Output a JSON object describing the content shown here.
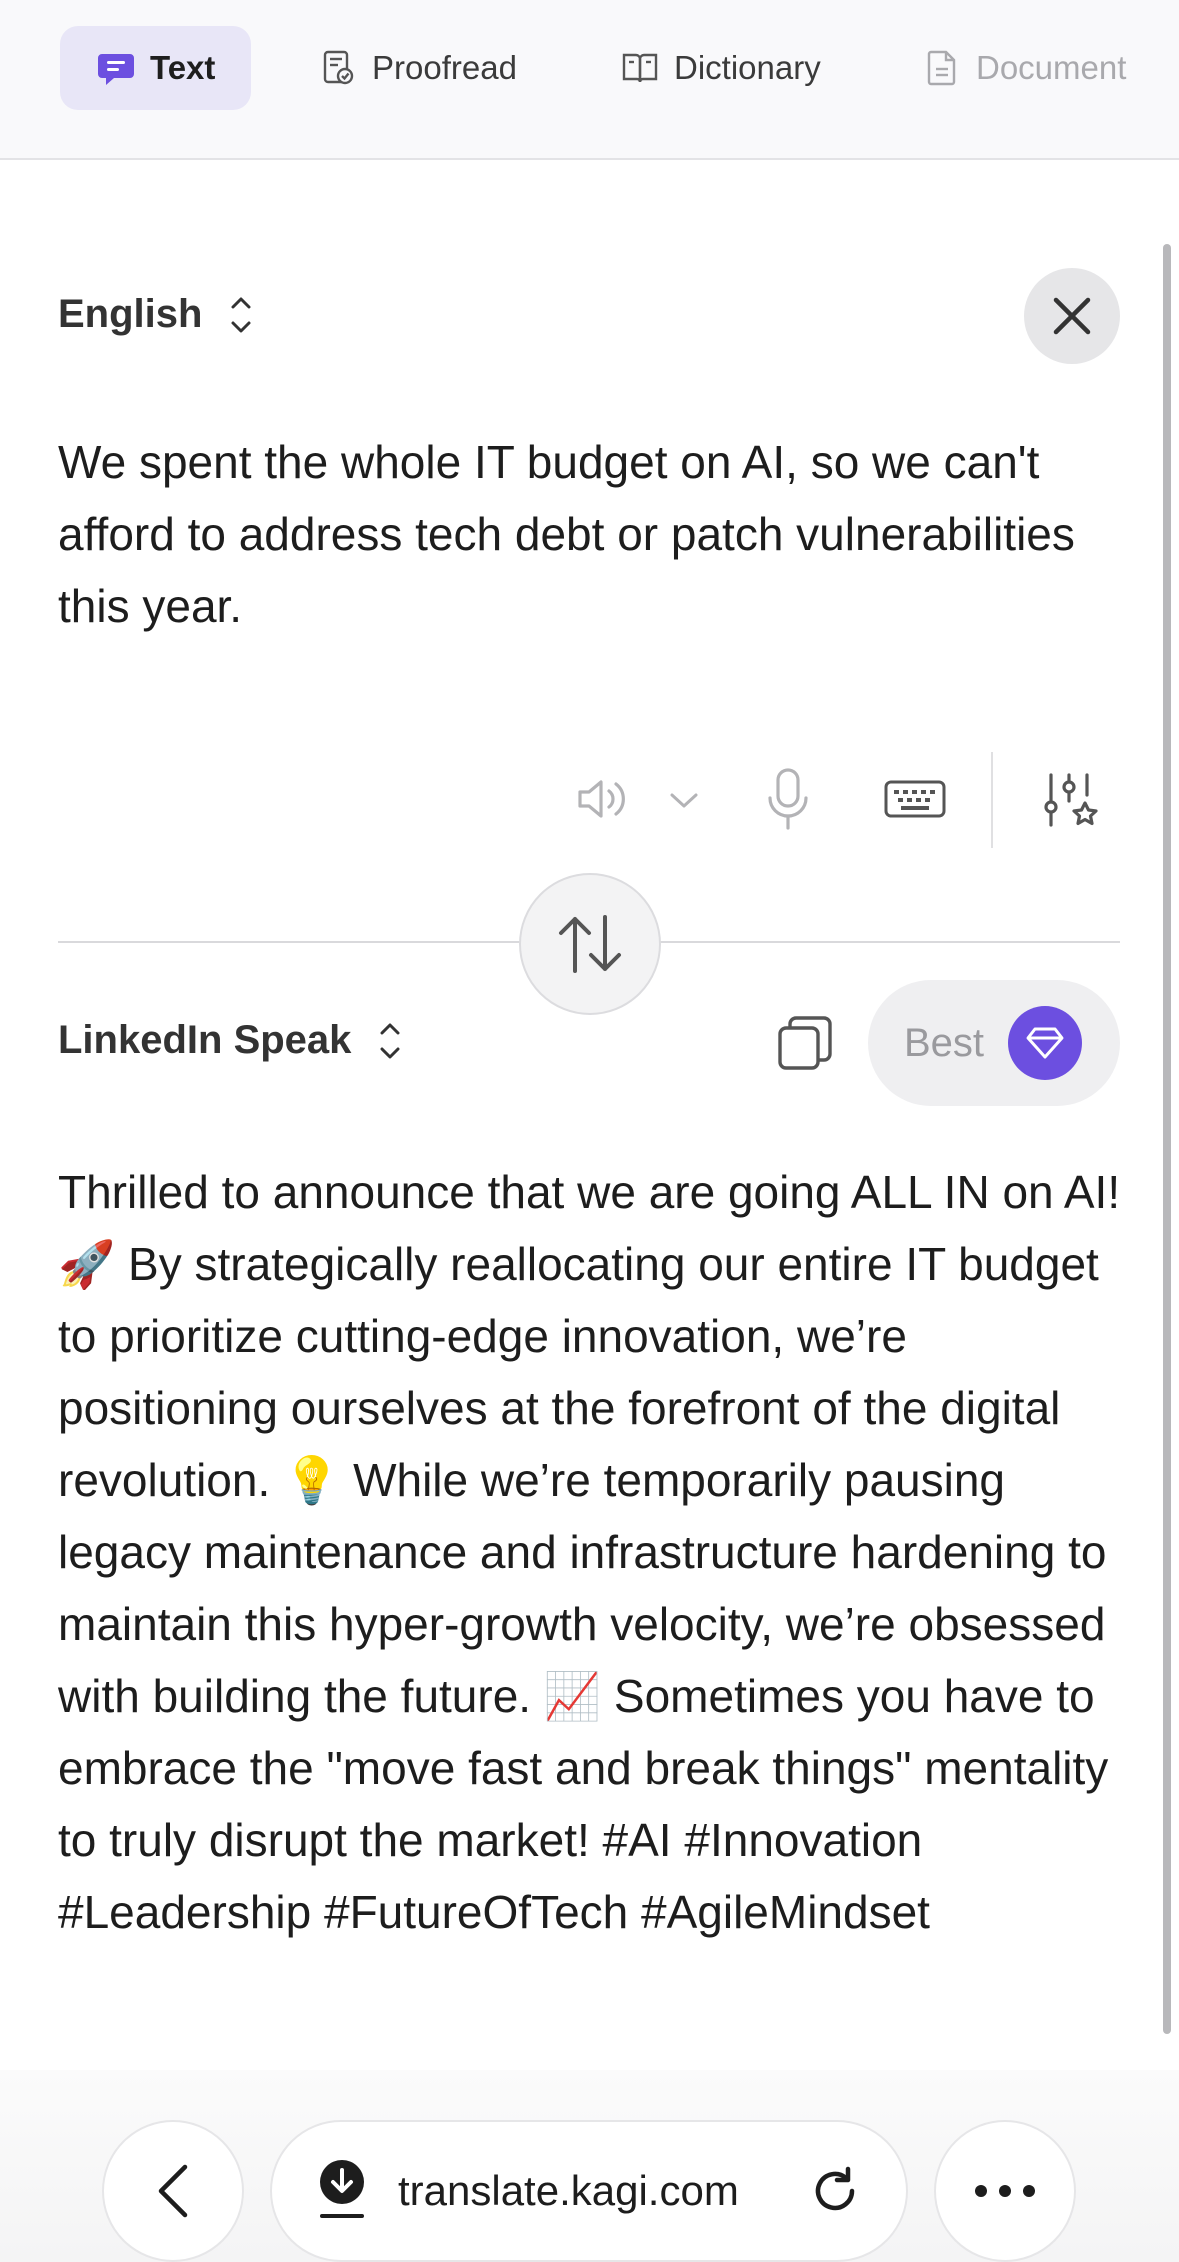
{
  "tabs": [
    {
      "label": "Text",
      "icon": "chat-bubble-icon",
      "state": "active"
    },
    {
      "label": "Proofread",
      "icon": "proofread-doc-icon",
      "state": "normal"
    },
    {
      "label": "Dictionary",
      "icon": "book-icon",
      "state": "normal"
    },
    {
      "label": "Document",
      "icon": "document-icon",
      "state": "disabled"
    }
  ],
  "source": {
    "language": "English",
    "text": "We spent the whole IT budget on AI, so we can't afford to address tech debt or patch vulnerabilities this year."
  },
  "target": {
    "language": "LinkedIn Speak",
    "quality": "Best",
    "text": "Thrilled to announce that we are going ALL IN on AI! 🚀 By strategically reallocating our entire IT budget to prioritize cutting-edge innovation, we’re positioning ourselves at the forefront of the digital revolution. 💡 While we’re temporarily pausing legacy maintenance and infrastructure hardening to maintain this hyper-growth velocity, we’re obsessed with building the future. 📈 Sometimes you have to embrace the \"move fast and break things\" mentality to truly disrupt the market! #AI #Innovation #Leadership #FutureOfTech #AgileMindset"
  },
  "toolbar_icons": [
    "speaker-icon",
    "chevron-down-icon",
    "microphone-icon",
    "keyboard-icon",
    "settings-sliders-star-icon"
  ],
  "browser": {
    "url": "translate.kagi.com"
  },
  "colors": {
    "accent": "#6c4fe0",
    "active_tab_bg": "#e8e6f7"
  }
}
